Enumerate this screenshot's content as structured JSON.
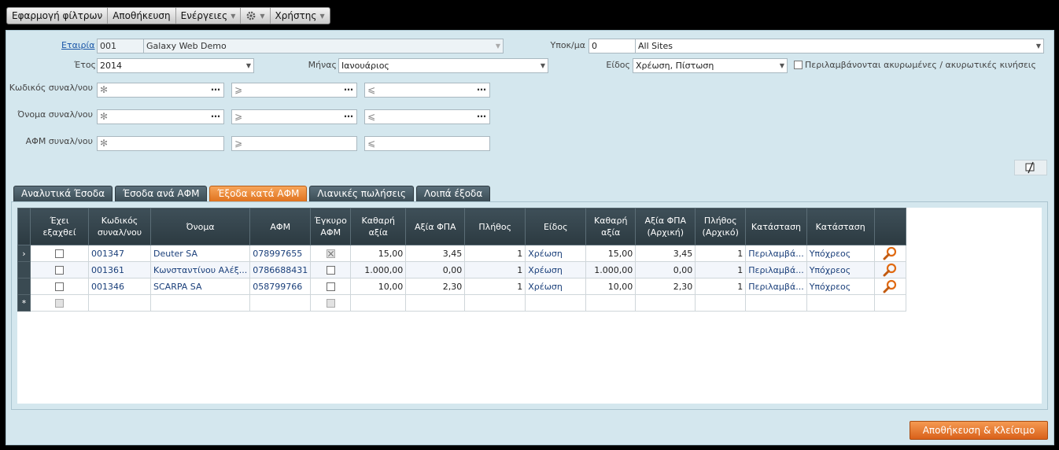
{
  "toolbar": {
    "apply_filters": "Εφαρμογή φίλτρων",
    "save": "Αποθήκευση",
    "actions": "Ενέργειες",
    "users": "Χρήστης"
  },
  "form": {
    "company_label": "Εταιρία",
    "company_code": "001",
    "company_name": "Galaxy Web Demo",
    "branch_label": "Υποκ/μα",
    "branch_code": "0",
    "branch_name": "All Sites",
    "year_label": "Έτος",
    "year_value": "2014",
    "month_label": "Μήνας",
    "month_value": "Ιανουάριος",
    "kind_label": "Είδος",
    "kind_value": "Χρέωση, Πίστωση",
    "include_cancelled_label": "Περιλαμβάνονται ακυρωμένες / ακυρωτικές κινήσεις",
    "code_label": "Κωδικός συναλ/νου",
    "name_label": "Όνομα συναλ/νου",
    "afm_label": "ΑΦΜ συναλ/νου",
    "op_any": "✻",
    "op_ge": "⩾",
    "op_le": "⩽"
  },
  "tabs": [
    {
      "label": "Αναλυτικά Έσοδα",
      "active": false
    },
    {
      "label": "Έσοδα ανά ΑΦΜ",
      "active": false
    },
    {
      "label": "Έξοδα κατά ΑΦΜ",
      "active": true
    },
    {
      "label": "Λιανικές πωλήσεις",
      "active": false
    },
    {
      "label": "Λοιπά έξοδα",
      "active": false
    }
  ],
  "grid": {
    "headers": [
      "Έχει εξαχθεί",
      "Κωδικός συναλ/νου",
      "Όνομα",
      "ΑΦΜ",
      "Έγκυρο ΑΦΜ",
      "Καθαρή αξία",
      "Αξία ΦΠΑ",
      "Πλήθος",
      "Είδος",
      "Καθαρή αξία",
      "Αξία ΦΠΑ (Αρχική)",
      "Πλήθος (Αρχικό)",
      "Κατάσταση",
      "Κατάσταση"
    ],
    "rows": [
      {
        "code": "001347",
        "name": "Deuter SA",
        "afm": "078997655",
        "net": "15,00",
        "vat": "3,45",
        "count": "1",
        "kind": "Χρέωση",
        "net_orig": "15,00",
        "vat_orig": "3,45",
        "count_orig": "1",
        "status1": "Περιλαμβά...",
        "status2": "Υπόχρεος"
      },
      {
        "code": "001361",
        "name": "Κωνσταντίνου Αλέξ...",
        "afm": "0786688431",
        "net": "1.000,00",
        "vat": "0,00",
        "count": "1",
        "kind": "Χρέωση",
        "net_orig": "1.000,00",
        "vat_orig": "0,00",
        "count_orig": "1",
        "status1": "Περιλαμβά...",
        "status2": "Υπόχρεος"
      },
      {
        "code": "001346",
        "name": "SCARPA SA",
        "afm": "058799766",
        "net": "10,00",
        "vat": "2,30",
        "count": "1",
        "kind": "Χρέωση",
        "net_orig": "10,00",
        "vat_orig": "2,30",
        "count_orig": "1",
        "status1": "Περιλαμβά...",
        "status2": "Υπόχρεος"
      }
    ],
    "current_row_marker": "›",
    "new_row_marker": "*"
  },
  "footer": {
    "save_close": "Αποθήκευση & Κλείσιμο"
  },
  "colors": {
    "panel_bg": "#d4e7ee",
    "header_bg": "#2c3a41",
    "accent_orange": "#e0731f"
  }
}
